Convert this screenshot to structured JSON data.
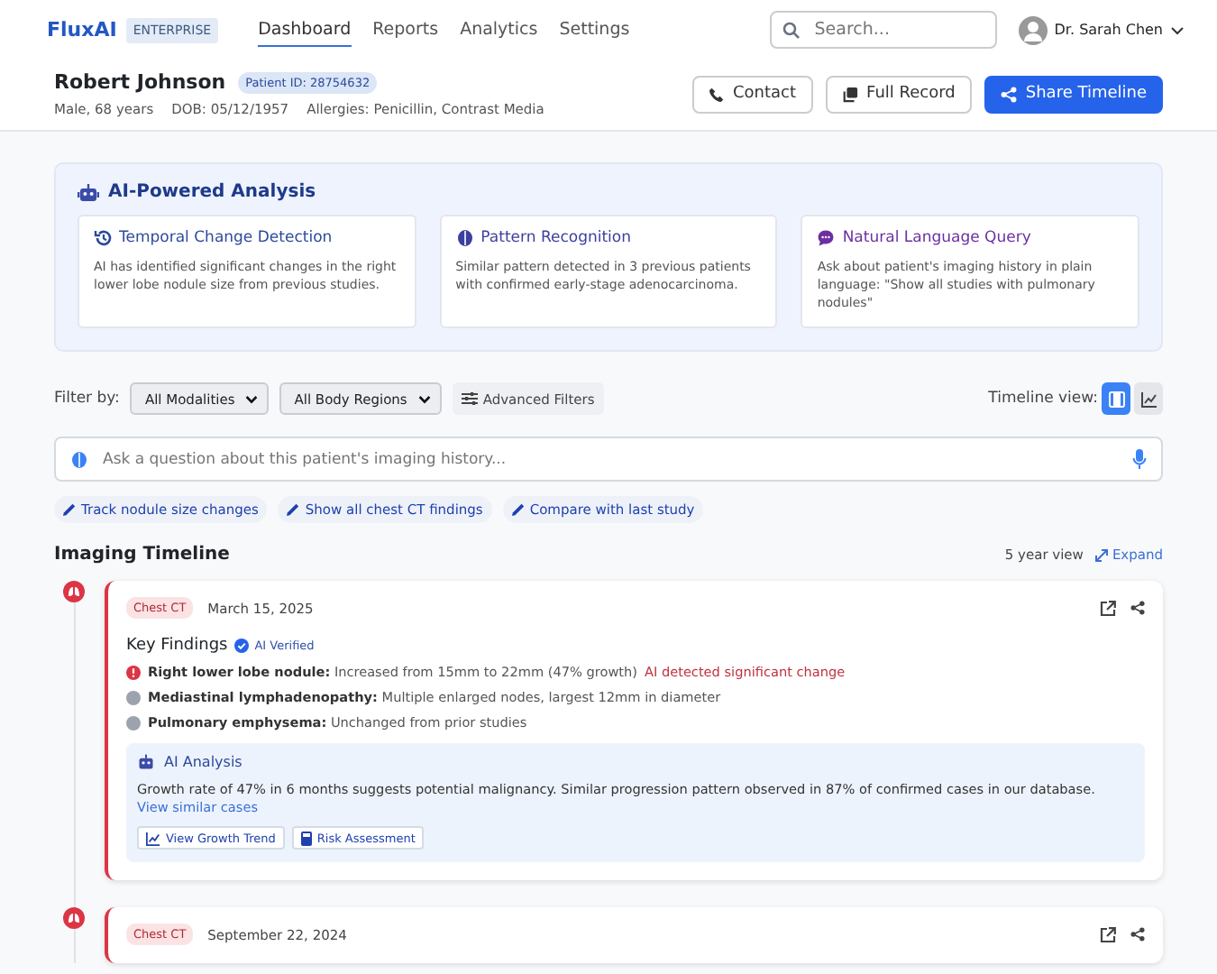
{
  "brand": {
    "name": "FluxAI",
    "badge": "ENTERPRISE"
  },
  "nav": [
    {
      "label": "Dashboard",
      "selected": true
    },
    {
      "label": "Reports",
      "selected": false
    },
    {
      "label": "Analytics",
      "selected": false
    },
    {
      "label": "Settings",
      "selected": false
    }
  ],
  "search": {
    "placeholder": "Search..."
  },
  "user": {
    "name": "Dr. Sarah Chen"
  },
  "patient": {
    "name": "Robert Johnson",
    "id": "Patient ID: 28754632",
    "sex_age": "Male, 68 years",
    "dob": "DOB: 05/12/1957",
    "allergies": "Allergies: Penicillin, Contrast Media"
  },
  "actions": [
    {
      "kind": "phone",
      "label": "Contact",
      "primary": false
    },
    {
      "kind": "record",
      "label": "Full Record",
      "primary": false
    },
    {
      "kind": "share",
      "label": "Share Timeline",
      "primary": true
    }
  ],
  "ai_panel": {
    "title": "AI-Powered Analysis",
    "cards": [
      {
        "kind": "history",
        "title": "Temporal Change Detection",
        "text": "AI has identified significant changes in the right lower lobe nodule size from previous studies.",
        "color": "#2d4a9a"
      },
      {
        "kind": "brain",
        "title": "Pattern Recognition",
        "text": "Similar pattern detected in 3 previous patients with confirmed early-stage adenocarcinoma.",
        "color": "#3b3f9e"
      },
      {
        "kind": "chat",
        "title": "Natural Language Query",
        "text": "Ask about patient's imaging history in plain language: \"Show all studies with pulmonary nodules\"",
        "color": "#6b2fa0"
      }
    ]
  },
  "filters": {
    "label": "Filter by:",
    "selects": [
      "All Modalities",
      "All Body Regions"
    ],
    "advanced": "Advanced Filters",
    "view_label": "Timeline view:",
    "views": [
      {
        "kind": "list",
        "selected": true
      },
      {
        "kind": "chart",
        "selected": false
      }
    ]
  },
  "query": {
    "placeholder": "Ask a question about this patient's imaging history..."
  },
  "suggestions": [
    "Track nodule size changes",
    "Show all chest CT findings",
    "Compare with last study"
  ],
  "timeline": {
    "title": "Imaging Timeline",
    "range": "5 year view",
    "expand": "Expand",
    "studies": [
      {
        "modality": "Chest CT",
        "date": "March 15, 2025",
        "findings_title": "Key Findings",
        "verified": "AI Verified",
        "findings": [
          {
            "alert": true,
            "label": "Right lower lobe nodule:",
            "text": "Increased from 15mm to 22mm (47% growth)",
            "flag": "AI detected significant change"
          },
          {
            "alert": false,
            "label": "Mediastinal lymphadenopathy:",
            "text": "Multiple enlarged nodes, largest 12mm in diameter"
          },
          {
            "alert": false,
            "label": "Pulmonary emphysema:",
            "text": "Unchanged from prior studies"
          }
        ],
        "analysis": {
          "title": "AI Analysis",
          "text": "Growth rate of 47% in 6 months suggests potential malignancy. Similar progression pattern observed in 87% of confirmed cases in our database.",
          "link": "View similar cases",
          "buttons": [
            {
              "kind": "trend",
              "label": "View Growth Trend"
            },
            {
              "kind": "calc",
              "label": "Risk Assessment"
            }
          ]
        }
      },
      {
        "modality": "Chest CT",
        "date": "September 22, 2024"
      }
    ]
  }
}
